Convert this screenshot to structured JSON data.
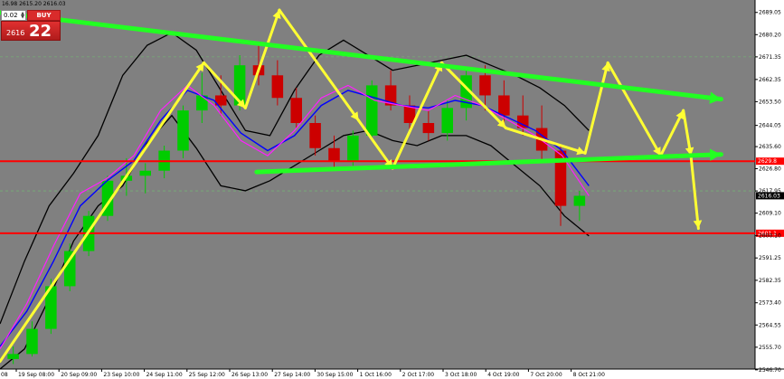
{
  "ohlc_header": "16.98 2615.20 2616.03",
  "trade_panel": {
    "lot_size": "0.02",
    "buy_label": "BUY",
    "price_prefix": "2616",
    "price_pips": "22"
  },
  "colors": {
    "plot_background": "#808080",
    "support_resistance": "#ff0000",
    "trend_channel": "#22ff22",
    "zigzag": "#ffff33",
    "bands": "#000000",
    "ma_fast": "#ff1fff",
    "ma_slow": "#0000ff",
    "bull_candle": "#00cc00",
    "bear_candle": "#cc0000"
  },
  "chart_data": {
    "type": "line",
    "title": "",
    "xlabel": "",
    "ylabel": "",
    "ylim": [
      2547.0,
      2694.0
    ],
    "y_ticks": [
      "2689.05",
      "2680.20",
      "2671.35",
      "2662.35",
      "2653.50",
      "2644.05",
      "2635.60",
      "2626.80",
      "2617.95",
      "2609.10",
      "2600.10",
      "2591.25",
      "2582.35",
      "2573.40",
      "2564.55",
      "2555.70",
      "2546.70"
    ],
    "x_ticks": [
      "19 Sep 08:00",
      "20 Sep 09:00",
      "23 Sep 10:00",
      "24 Sep 11:00",
      "25 Sep 12:00",
      "26 Sep 13:00",
      "27 Sep 14:00",
      "30 Sep 15:00",
      "1 Oct 16:00",
      "2 Oct 17:00",
      "3 Oct 18:00",
      "4 Oct 19:00",
      "7 Oct 20:00",
      "8 Oct 21:00"
    ],
    "x_tick_first_fragment": "08",
    "horizontal_levels": [
      {
        "value": 2629.8,
        "label": "2629.8"
      },
      {
        "value": 2601.1,
        "label": "2601.1"
      }
    ],
    "current_price_label": "2616.03",
    "trend_lines": [
      {
        "from": [
          0.34,
          2625.5
        ],
        "to": [
          0.955,
          2632.5
        ]
      },
      {
        "from": [
          0.0,
          2689.0
        ],
        "to": [
          0.955,
          2654.5
        ]
      }
    ],
    "zigzag_path": [
      [
        0.0,
        2550.0
      ],
      [
        0.27,
        2669.0
      ],
      [
        0.325,
        2651.0
      ],
      [
        0.37,
        2690.0
      ],
      [
        0.475,
        2646.0
      ],
      [
        0.52,
        2627.0
      ],
      [
        0.585,
        2669.0
      ],
      [
        0.67,
        2643.0
      ],
      [
        0.775,
        2633.0
      ],
      [
        0.805,
        2669.0
      ],
      [
        0.875,
        2632.0
      ],
      [
        0.905,
        2650.0
      ],
      [
        0.915,
        2632.0
      ],
      [
        0.925,
        2603.0
      ]
    ],
    "candles_approx": [
      [
        2551,
        2556,
        2549,
        2553
      ],
      [
        2553,
        2566,
        2552,
        2563
      ],
      [
        2563,
        2583,
        2561,
        2580
      ],
      [
        2580,
        2597,
        2578,
        2594
      ],
      [
        2594,
        2610,
        2592,
        2608
      ],
      [
        2608,
        2624,
        2606,
        2622
      ],
      [
        2622,
        2631,
        2616,
        2624
      ],
      [
        2624,
        2629,
        2617,
        2626
      ],
      [
        2626,
        2636,
        2623,
        2634
      ],
      [
        2634,
        2652,
        2631,
        2650
      ],
      [
        2650,
        2665,
        2645,
        2656
      ],
      [
        2656,
        2664,
        2648,
        2652
      ],
      [
        2652,
        2672,
        2650,
        2668
      ],
      [
        2668,
        2676,
        2660,
        2664
      ],
      [
        2664,
        2670,
        2652,
        2655
      ],
      [
        2655,
        2659,
        2643,
        2645
      ],
      [
        2645,
        2648,
        2632,
        2635
      ],
      [
        2635,
        2640,
        2626,
        2630
      ],
      [
        2630,
        2642,
        2628,
        2640
      ],
      [
        2640,
        2662,
        2638,
        2660
      ],
      [
        2660,
        2666,
        2650,
        2652
      ],
      [
        2652,
        2656,
        2642,
        2645
      ],
      [
        2645,
        2650,
        2638,
        2641
      ],
      [
        2641,
        2654,
        2638,
        2651
      ],
      [
        2651,
        2666,
        2646,
        2664
      ],
      [
        2664,
        2668,
        2650,
        2656
      ],
      [
        2656,
        2662,
        2644,
        2648
      ],
      [
        2648,
        2656,
        2640,
        2643
      ],
      [
        2643,
        2652,
        2630,
        2634
      ],
      [
        2634,
        2636,
        2604,
        2612
      ],
      [
        2612,
        2618,
        2606,
        2616
      ]
    ],
    "bands": {
      "upper": [
        2565,
        2590,
        2612,
        2625,
        2640,
        2664,
        2676,
        2681,
        2674,
        2658,
        2642,
        2640,
        2658,
        2672,
        2678,
        2672,
        2666,
        2668,
        2670,
        2672,
        2668,
        2664,
        2659,
        2652,
        2642
      ],
      "lower": [
        2547,
        2555,
        2575,
        2598,
        2612,
        2620,
        2637,
        2648,
        2635,
        2620,
        2618,
        2622,
        2628,
        2634,
        2640,
        2642,
        2638,
        2636,
        2640,
        2640,
        2636,
        2628,
        2620,
        2608,
        2600
      ]
    },
    "moving_averages": {
      "fast": [
        2555,
        2573,
        2596,
        2617,
        2623,
        2632,
        2650,
        2660,
        2652,
        2638,
        2632,
        2642,
        2655,
        2660,
        2654,
        2652,
        2650,
        2656,
        2652,
        2646,
        2640,
        2632,
        2616
      ],
      "slow": [
        2556,
        2570,
        2590,
        2612,
        2622,
        2630,
        2646,
        2658,
        2654,
        2641,
        2634,
        2640,
        2652,
        2658,
        2655,
        2652,
        2651,
        2654,
        2652,
        2647,
        2642,
        2634,
        2620
      ]
    }
  }
}
